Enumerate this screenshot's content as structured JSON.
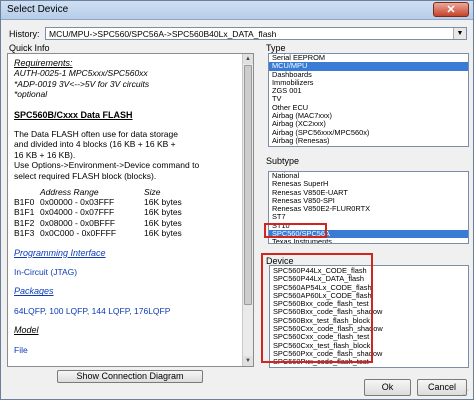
{
  "window": {
    "title": "Select Device",
    "close_glyph": "✕"
  },
  "history": {
    "label": "History:",
    "value": "MCU/MPU->SPC560/SPC56A->SPC560B40Lx_DATA_flash"
  },
  "quick_info": {
    "label": "Quick Info",
    "requirements_heading": "Requirements:",
    "requirements": [
      "AUTH-0025-1 MPC5xxx/SPC560xx",
      "*ADP-0019 3V<-->5V for 3V circuits",
      "*optional"
    ],
    "flash_heading": "SPC560B/Cxxx Data FLASH",
    "description": [
      "The Data FLASH often use for data storage",
      "and divided into 4 blocks (16 KB + 16 KB +",
      "16 KB + 16 KB)."
    ],
    "use_line": [
      "Use Options->Environment->Device command to",
      "select required FLASH block (blocks)."
    ],
    "table_headers": {
      "range": "Address Range",
      "size": "Size"
    },
    "blocks": [
      {
        "name": "B1F0",
        "range": "0x00000 - 0x03FFF",
        "size": "16K bytes"
      },
      {
        "name": "B1F1",
        "range": "0x04000 - 0x07FFF",
        "size": "16K bytes"
      },
      {
        "name": "B1F2",
        "range": "0x08000 - 0x0BFFF",
        "size": "16K bytes"
      },
      {
        "name": "B1F3",
        "range": "0x0C000 - 0x0FFFF",
        "size": "16K bytes"
      }
    ],
    "programming_interface_heading": "Programming Interface",
    "programming_interface": "In-Circuit (JTAG)",
    "packages_heading": "Packages",
    "packages": "64LQFP, 100 LQFP, 144 LQFP, 176LQFP",
    "model_heading": "Model",
    "model": "File",
    "scroll_fraction": 0.0
  },
  "type": {
    "label": "Type",
    "items": [
      "Serial EEPROM",
      "MCU/MPU",
      "Dashboards",
      "Immobilizers",
      "ZGS 001",
      "TV",
      "Other ECU",
      "Airbag (MAC7xxx)",
      "Airbag (XC2xxx)",
      "Airbag (SPC56xxx/MPC560x)",
      "Airbag (Renesas)"
    ],
    "selected_index": 1
  },
  "subtype": {
    "label": "Subtype",
    "items": [
      "National",
      "Renesas SuperH",
      "Renesas V850E-UART",
      "Renesas V850-SPI",
      "Renesas V850E2-FLUR0RTX",
      "ST7",
      "ST10",
      "SPC560/SPC56A",
      "Texas Instruments"
    ],
    "selected_index": 7
  },
  "device": {
    "label": "Device",
    "items": [
      "SPC560P44Lx_CODE_flash",
      "SPC560P44Lx_DATA_flash",
      "SPC560AP54Lx_CODE_flash",
      "SPC560AP60Lx_CODE_flash",
      "SPC560Bxx_code_flash_test",
      "SPC560Bxx_code_flash_shadow",
      "SPC560Bxx_test_flash_block",
      "SPC560Cxx_code_flash_shadow",
      "SPC560Cxx_code_flash_test",
      "SPC560Cxx_test_flash_block",
      "SPC560Pxx_code_flash_shadow",
      "SPC560Pxx_code_flash_test"
    ]
  },
  "buttons": {
    "show_diagram": "Show Connection Diagram",
    "ok": "Ok",
    "cancel": "Cancel"
  },
  "colors": {
    "selection": "#3a7bd5",
    "highlight_box": "#d0261f"
  }
}
